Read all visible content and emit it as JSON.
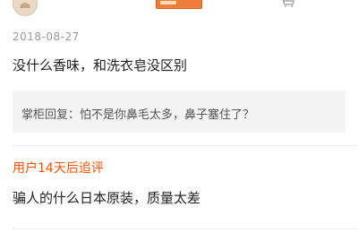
{
  "review": {
    "date": "2018-08-27",
    "text": "没什么香味，和洗衣皂没区别",
    "seller_reply": "掌柜回复：怕不是你鼻毛太多，鼻子塞住了？"
  },
  "followup": {
    "title": "用户14天后追评",
    "text": "骗人的什么日本原装，质量太差"
  },
  "icons": {
    "avatar": "user-avatar",
    "badge": "store-badge",
    "cart": "cart-icon"
  },
  "colors": {
    "accent": "#ff5000",
    "reply_bg": "#f4f4f4",
    "date": "#9a9a9a"
  }
}
